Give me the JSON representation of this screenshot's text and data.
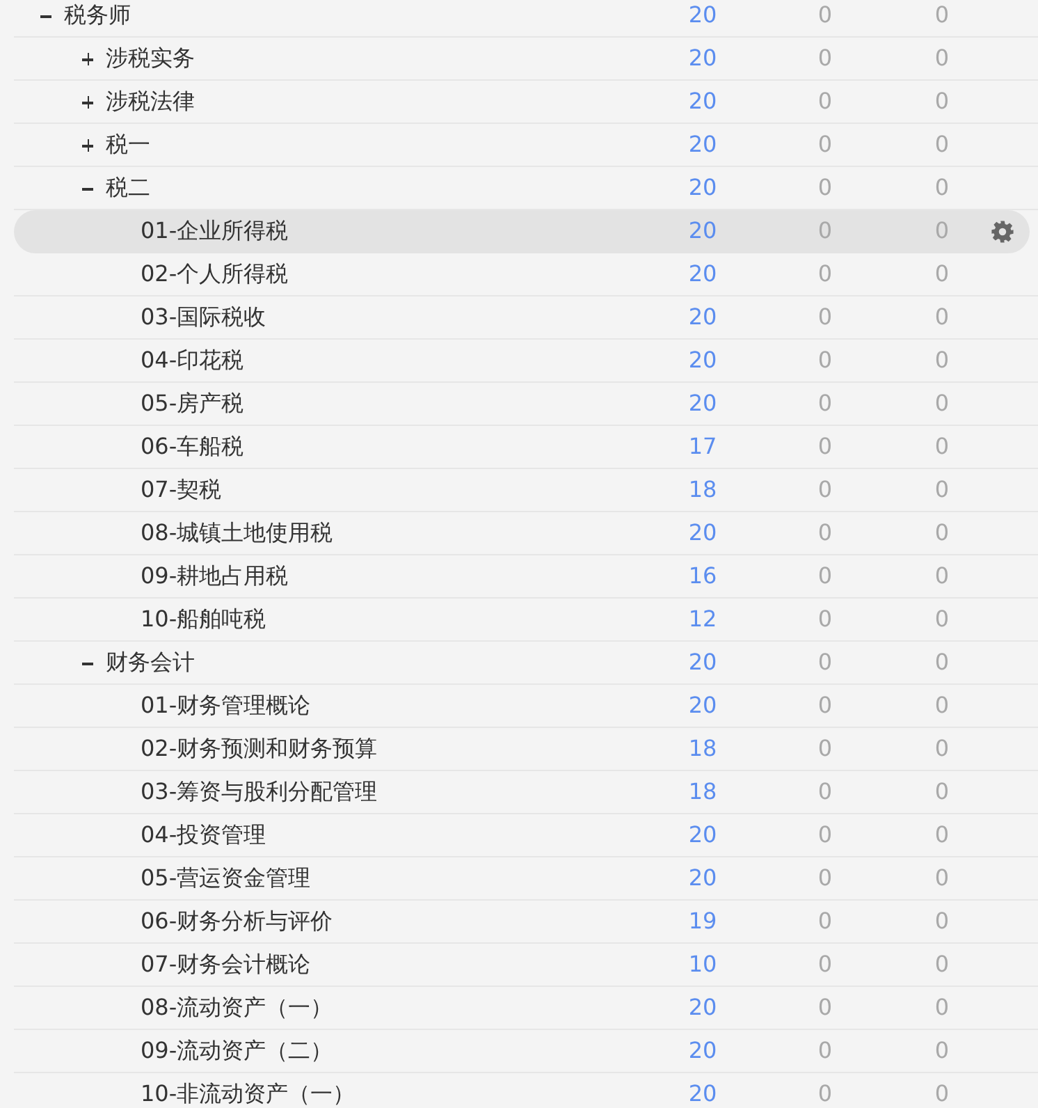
{
  "tree": [
    {
      "label": "税务师",
      "expanded": true,
      "selected": false,
      "column_2": "20",
      "column_3": "0",
      "column_4": "0",
      "children": [
        {
          "label": "涉税实务",
          "expanded": false,
          "selected": false,
          "column_2": "20",
          "column_3": "0",
          "column_4": "0"
        },
        {
          "label": "涉税法律",
          "expanded": false,
          "selected": false,
          "column_2": "20",
          "column_3": "0",
          "column_4": "0"
        },
        {
          "label": "税一",
          "expanded": false,
          "selected": false,
          "column_2": "20",
          "column_3": "0",
          "column_4": "0"
        },
        {
          "label": "税二",
          "expanded": true,
          "selected": false,
          "column_2": "20",
          "column_3": "0",
          "column_4": "0",
          "children": [
            {
              "label": "01-企业所得税",
              "selected": true,
              "column_2": "20",
              "column_3": "0",
              "column_4": "0"
            },
            {
              "label": "02-个人所得税",
              "selected": false,
              "column_2": "20",
              "column_3": "0",
              "column_4": "0"
            },
            {
              "label": "03-国际税收",
              "selected": false,
              "column_2": "20",
              "column_3": "0",
              "column_4": "0"
            },
            {
              "label": "04-印花税",
              "selected": false,
              "column_2": "20",
              "column_3": "0",
              "column_4": "0"
            },
            {
              "label": "05-房产税",
              "selected": false,
              "column_2": "20",
              "column_3": "0",
              "column_4": "0"
            },
            {
              "label": "06-车船税",
              "selected": false,
              "column_2": "17",
              "column_3": "0",
              "column_4": "0"
            },
            {
              "label": "07-契税",
              "selected": false,
              "column_2": "18",
              "column_3": "0",
              "column_4": "0"
            },
            {
              "label": "08-城镇土地使用税",
              "selected": false,
              "column_2": "20",
              "column_3": "0",
              "column_4": "0"
            },
            {
              "label": "09-耕地占用税",
              "selected": false,
              "column_2": "16",
              "column_3": "0",
              "column_4": "0"
            },
            {
              "label": "10-船舶吨税",
              "selected": false,
              "column_2": "12",
              "column_3": "0",
              "column_4": "0"
            }
          ]
        },
        {
          "label": "财务会计",
          "expanded": true,
          "selected": false,
          "column_2": "20",
          "column_3": "0",
          "column_4": "0",
          "children": [
            {
              "label": "01-财务管理概论",
              "selected": false,
              "column_2": "20",
              "column_3": "0",
              "column_4": "0"
            },
            {
              "label": "02-财务预测和财务预算",
              "selected": false,
              "column_2": "18",
              "column_3": "0",
              "column_4": "0"
            },
            {
              "label": "03-筹资与股利分配管理",
              "selected": false,
              "column_2": "18",
              "column_3": "0",
              "column_4": "0"
            },
            {
              "label": "04-投资管理",
              "selected": false,
              "column_2": "20",
              "column_3": "0",
              "column_4": "0"
            },
            {
              "label": "05-营运资金管理",
              "selected": false,
              "column_2": "20",
              "column_3": "0",
              "column_4": "0"
            },
            {
              "label": "06-财务分析与评价",
              "selected": false,
              "column_2": "19",
              "column_3": "0",
              "column_4": "0"
            },
            {
              "label": "07-财务会计概论",
              "selected": false,
              "column_2": "10",
              "column_3": "0",
              "column_4": "0"
            },
            {
              "label": "08-流动资产（一）",
              "selected": false,
              "column_2": "20",
              "column_3": "0",
              "column_4": "0"
            },
            {
              "label": "09-流动资产（二）",
              "selected": false,
              "column_2": "20",
              "column_3": "0",
              "column_4": "0"
            },
            {
              "label": "10-非流动资产（一）",
              "selected": false,
              "column_2": "20",
              "column_3": "0",
              "column_4": "0"
            }
          ]
        }
      ]
    }
  ]
}
